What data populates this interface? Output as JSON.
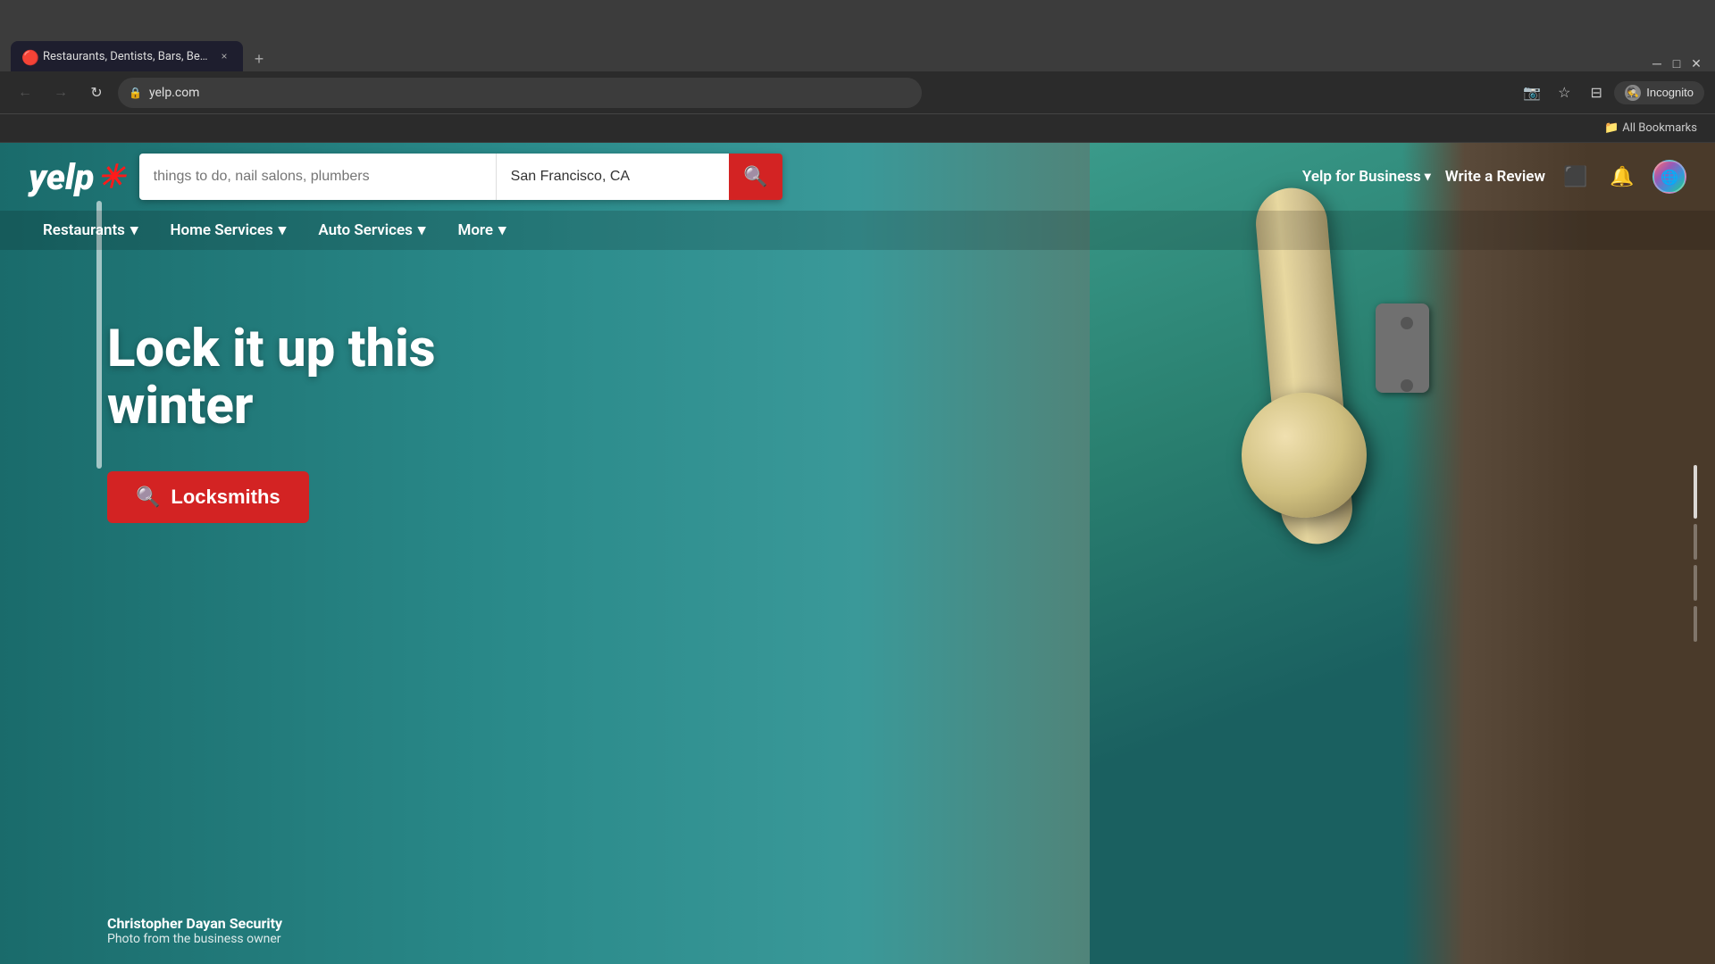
{
  "browser": {
    "tab": {
      "title": "Restaurants, Dentists, Bars, Bea...",
      "favicon": "🔴",
      "close_label": "×"
    },
    "new_tab_label": "+",
    "address": "yelp.com",
    "nav_buttons": {
      "back": "←",
      "forward": "→",
      "refresh": "↻"
    },
    "incognito_label": "Incognito",
    "bookmarks_label": "All Bookmarks"
  },
  "yelp": {
    "logo_text": "yelp",
    "search": {
      "find_placeholder": "things to do, nail salons, plumbers",
      "location_value": "San Francisco, CA",
      "button_label": "🔍"
    },
    "nav_right": {
      "yelp_for_business": "Yelp for Business",
      "write_review": "Write a Review"
    },
    "main_nav": [
      {
        "label": "Restaurants",
        "has_dropdown": true
      },
      {
        "label": "Home Services",
        "has_dropdown": true
      },
      {
        "label": "Auto Services",
        "has_dropdown": true
      },
      {
        "label": "More",
        "has_dropdown": true
      }
    ],
    "hero": {
      "title": "Lock it up this winter",
      "cta_label": "Locksmiths",
      "cta_icon": "🔍"
    },
    "photo_credit": {
      "name": "Christopher Dayan Security",
      "sub": "Photo from the business owner"
    }
  }
}
